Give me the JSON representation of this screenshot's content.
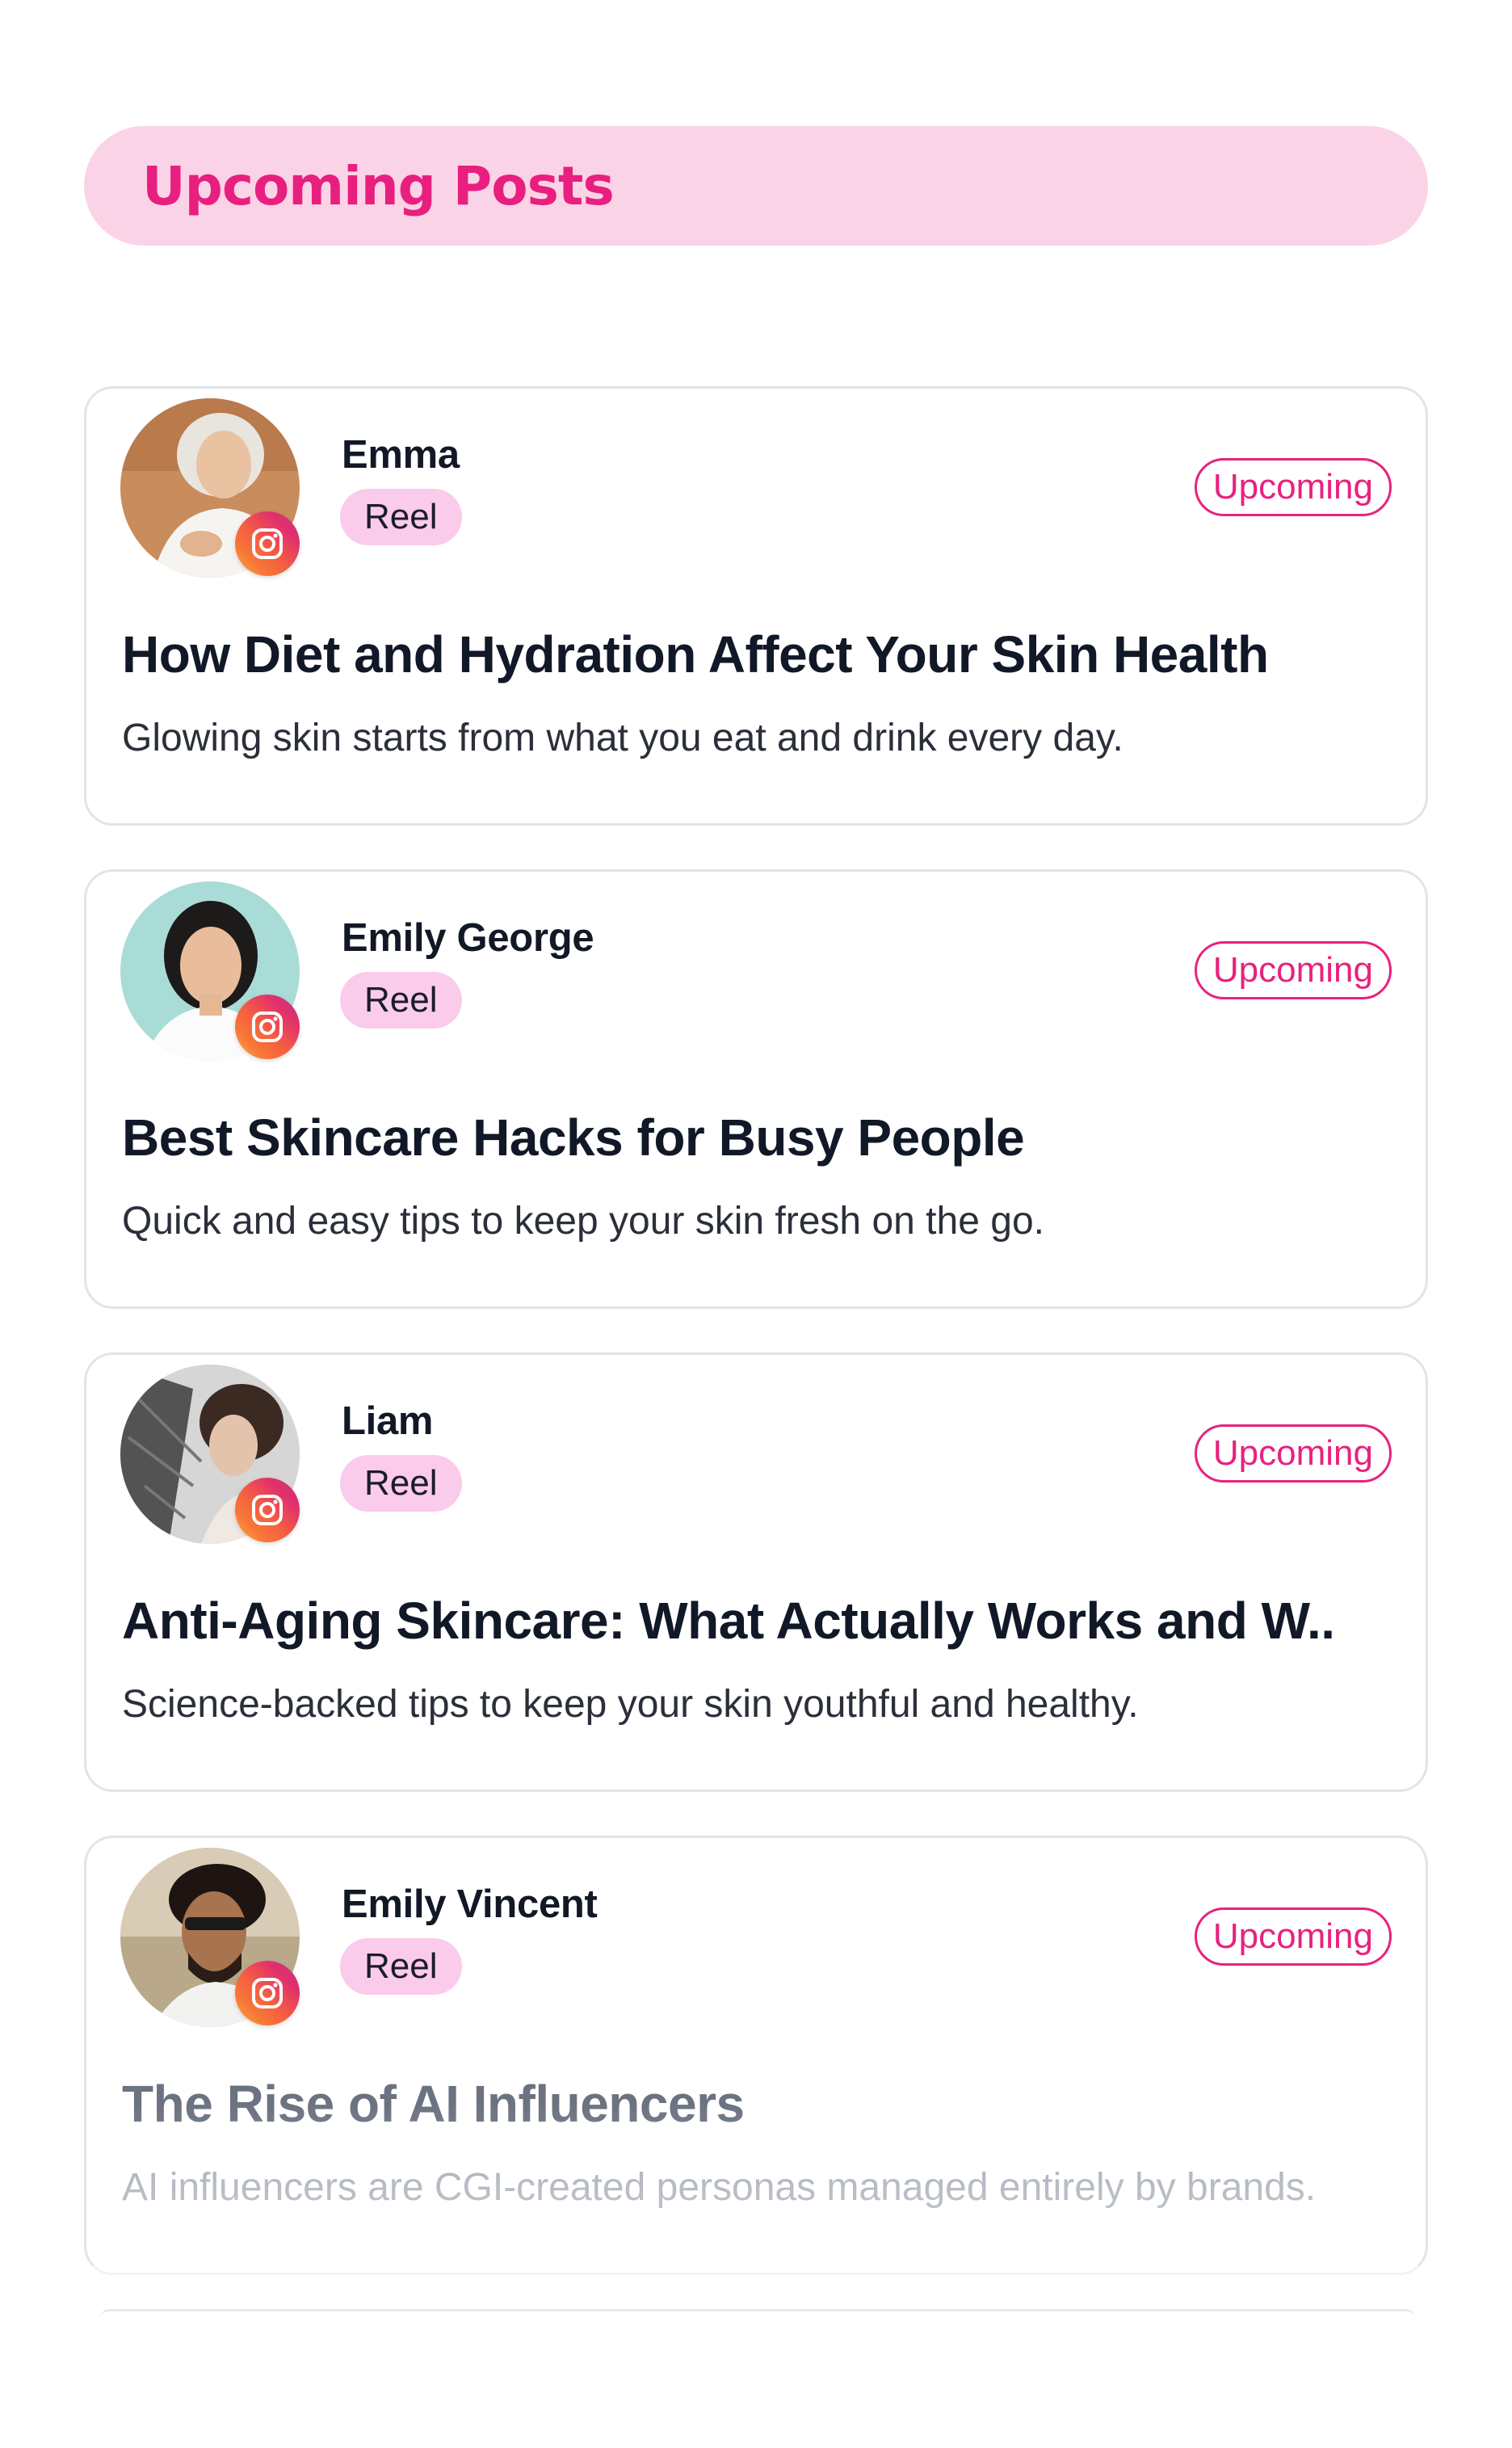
{
  "header": {
    "title": "Upcoming Posts",
    "accent_color": "#e81f7e",
    "background_color": "#fbd3e7"
  },
  "posts": [
    {
      "author": "Emma",
      "type": "Reel",
      "status": "Upcoming",
      "platform_icon": "instagram-icon",
      "title": "How Diet and Hydration Affect Your Skin Health",
      "description": "Glowing skin starts from what you eat and drink every day."
    },
    {
      "author": "Emily George",
      "type": "Reel",
      "status": "Upcoming",
      "platform_icon": "instagram-icon",
      "title": "Best Skincare Hacks for Busy People",
      "description": "Quick and easy tips to keep your skin fresh on the go."
    },
    {
      "author": "Liam",
      "type": "Reel",
      "status": "Upcoming",
      "platform_icon": "instagram-icon",
      "title": "Anti-Aging Skincare: What Actually Works and W..",
      "description": "Science-backed tips to keep your skin youthful and healthy."
    },
    {
      "author": "Emily Vincent",
      "type": "Reel",
      "status": "Upcoming",
      "platform_icon": "instagram-icon",
      "title": "The Rise of AI Influencers",
      "description": "AI influencers are CGI-created personas managed entirely by brands."
    }
  ]
}
